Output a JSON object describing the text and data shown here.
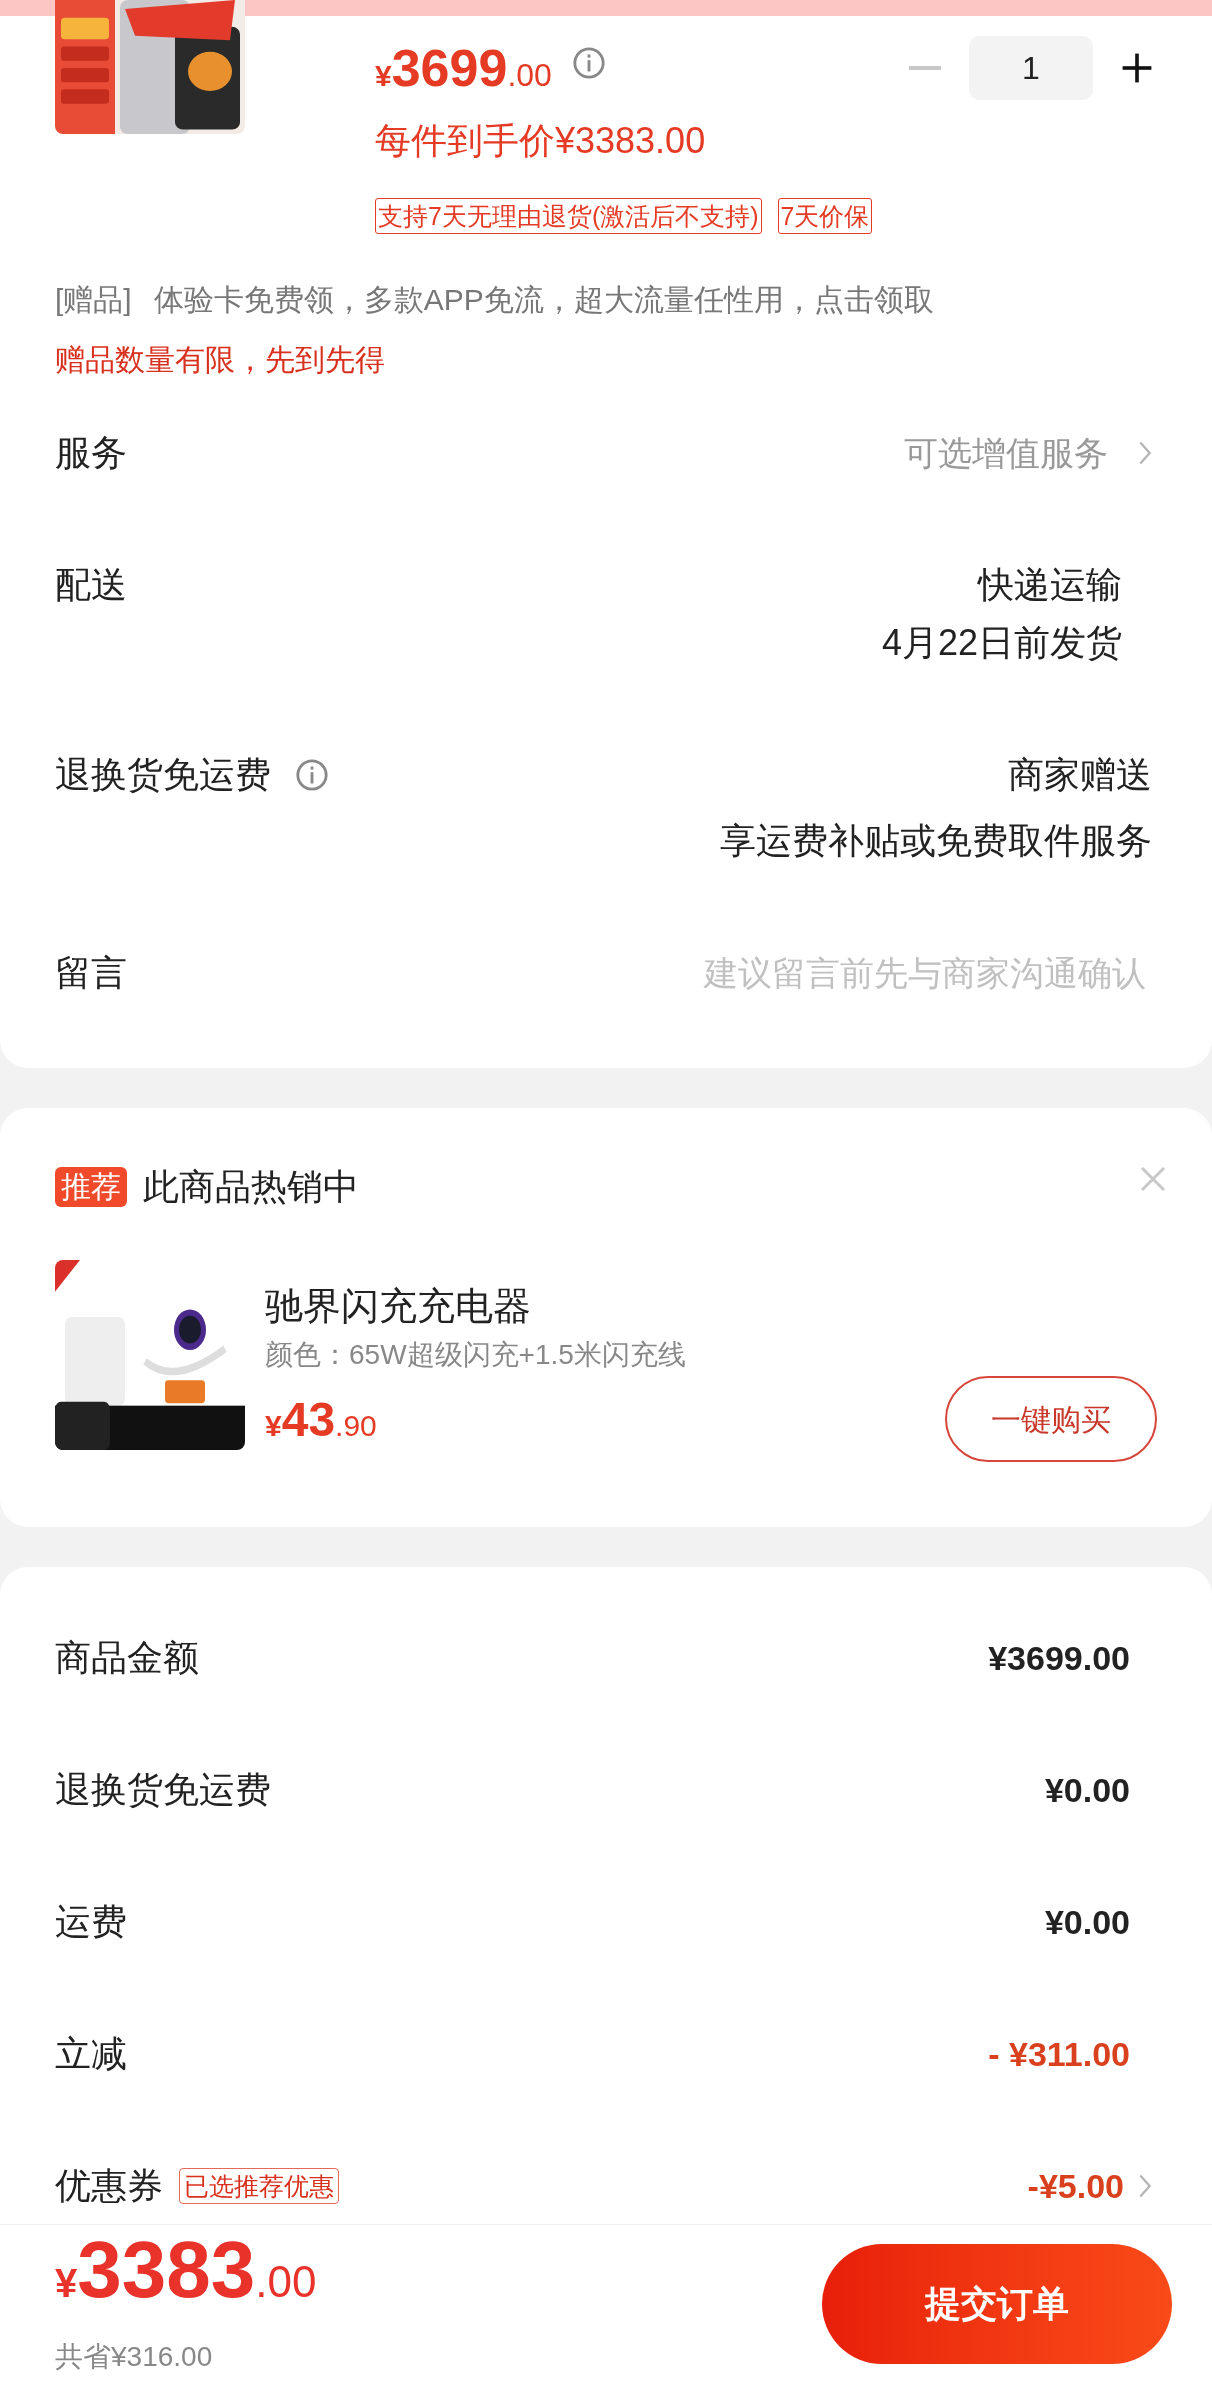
{
  "product": {
    "currency": "¥",
    "price_int": "3699",
    "price_dec": ".00",
    "final_price": "每件到手价¥3383.00",
    "quantity": "1",
    "minus_disabled": true,
    "tags": [
      "支持7天无理由退货(激活后不支持)",
      "7天价保"
    ]
  },
  "gift": {
    "label": "[赠品]",
    "text": "体验卡免费领，多款APP免流，超大流量任性用，点击领取",
    "note": "赠品数量有限，先到先得"
  },
  "rows": [
    {
      "kind": "link",
      "label": "服务",
      "info": false,
      "lines": [
        "可选增值服务"
      ]
    },
    {
      "kind": "text",
      "label": "配送",
      "info": false,
      "lines": [
        "快递运输",
        "4月22日前发货"
      ]
    },
    {
      "kind": "text",
      "label": "退换货免运费",
      "info": true,
      "lines": [
        "商家赠送",
        "享运费补贴或免费取件服务"
      ]
    },
    {
      "kind": "field",
      "label": "留言",
      "info": false,
      "placeholder": "建议留言前先与商家沟通确认"
    }
  ],
  "recommend": {
    "badge": "推荐",
    "title": "此商品热销中",
    "item": {
      "name": "驰界闪充充电器",
      "spec": "颜色：65W超级闪充+1.5米闪充线",
      "currency": "¥",
      "price_int": "43",
      "price_dec": ".90",
      "button": "一键购买"
    }
  },
  "summary": [
    {
      "label": "商品金额",
      "value": "¥3699.00",
      "highlight": false
    },
    {
      "label": "退换货免运费",
      "value": "¥0.00",
      "highlight": false
    },
    {
      "label": "运费",
      "value": "¥0.00",
      "highlight": false
    },
    {
      "label": "立减",
      "value": "- ¥311.00",
      "highlight": true
    },
    {
      "label": "优惠券",
      "badge": "已选推荐优惠",
      "value": "-¥5.00",
      "highlight": true,
      "chevron": true
    }
  ],
  "footer": {
    "currency": "¥",
    "total_int": "3383",
    "total_dec": ".00",
    "saved": "共省¥316.00",
    "submit": "提交订单"
  }
}
